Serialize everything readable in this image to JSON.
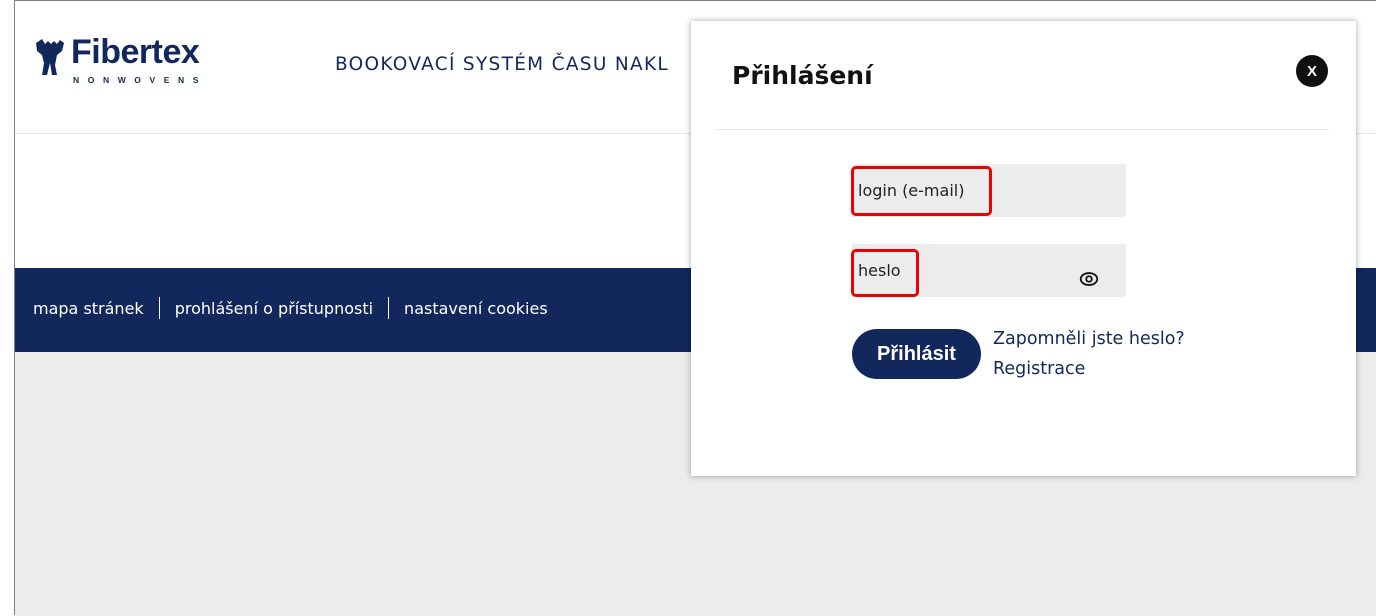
{
  "header": {
    "logo_text": "Fibertex",
    "logo_subtext": "NONWOVENS",
    "site_title": "BOOKOVACÍ SYSTÉM ČASU NAKL"
  },
  "footer_nav": {
    "items": [
      {
        "label": "mapa stránek"
      },
      {
        "label": "prohlášení o přístupnosti"
      },
      {
        "label": "nastavení cookies"
      }
    ]
  },
  "login_modal": {
    "title": "Přihlášení",
    "close_label": "X",
    "login_placeholder": "login (e-mail)",
    "password_placeholder": "heslo",
    "password_toggle_icon": "eye-icon",
    "submit_label": "Přihlásit",
    "forgot_password_link": "Zapomněli jste heslo?",
    "register_link": "Registrace"
  },
  "colors": {
    "brand_navy": "#12285c",
    "highlight_red": "#e00000",
    "field_bg": "#ececec"
  }
}
